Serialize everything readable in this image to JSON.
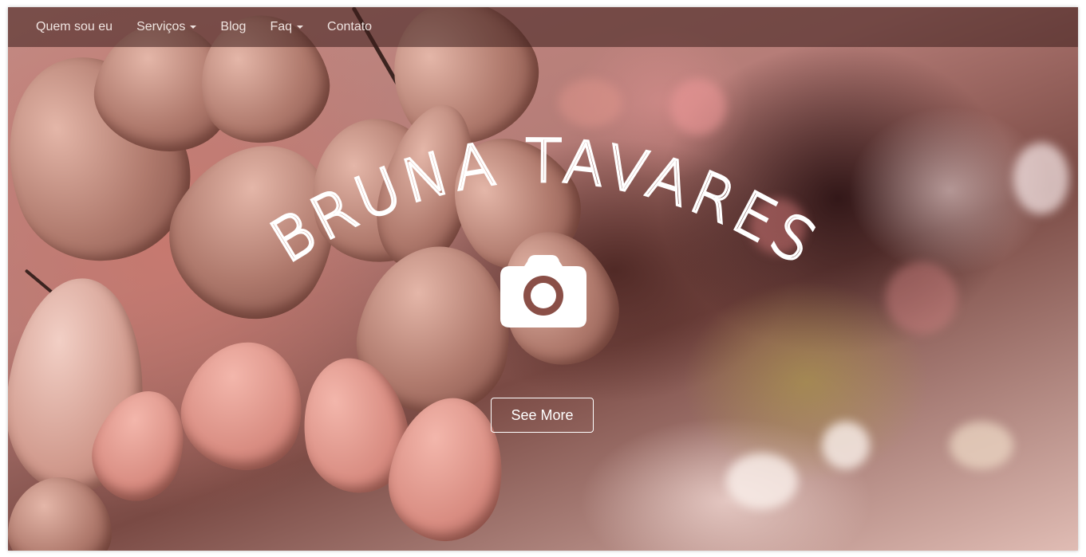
{
  "navbar": {
    "items": [
      {
        "label": "Quem sou eu",
        "dropdown": false
      },
      {
        "label": "Serviços",
        "dropdown": true
      },
      {
        "label": "Blog",
        "dropdown": false
      },
      {
        "label": "Faq",
        "dropdown": true
      },
      {
        "label": "Contato",
        "dropdown": false
      }
    ]
  },
  "hero": {
    "title": "BRUNA TAVARES",
    "icon": "camera-icon",
    "button_label": "See More"
  },
  "colors": {
    "text": "#ffffff",
    "navbar_bg": "rgba(60,30,28,0.55)",
    "nav_text": "#efe3e0"
  }
}
